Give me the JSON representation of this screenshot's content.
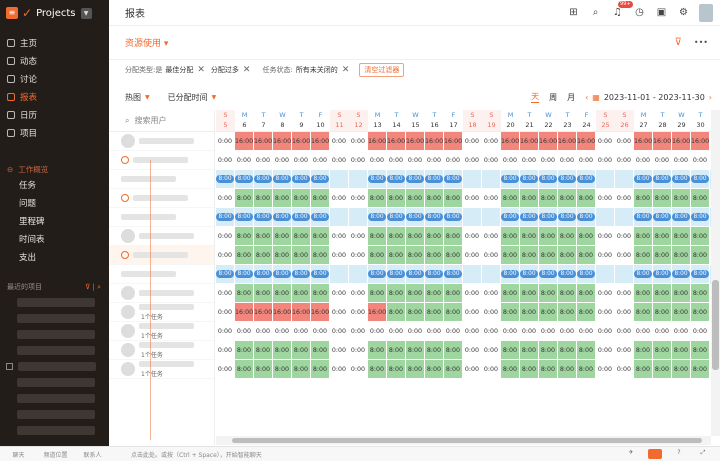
{
  "app": {
    "name": "Projects",
    "logo_letter": "≡",
    "logo_check": "✓"
  },
  "sidebar": {
    "nav": [
      {
        "label": "主页",
        "name": "home"
      },
      {
        "label": "动态",
        "name": "activity"
      },
      {
        "label": "讨论",
        "name": "discussion"
      },
      {
        "label": "报表",
        "name": "reports",
        "active": true
      },
      {
        "label": "日历",
        "name": "calendar"
      },
      {
        "label": "项目",
        "name": "projects"
      }
    ],
    "work_section": "工作概览",
    "work_items": [
      "任务",
      "问题",
      "里程碑",
      "时间表",
      "支出"
    ],
    "recent_title": "最近的项目"
  },
  "bottom": {
    "items": [
      "聊天",
      "频道位置",
      "联系人"
    ],
    "hint": "点击此处。或按（Ctrl + Space），开始智能聊天"
  },
  "header": {
    "title": "报表",
    "badge": "99+"
  },
  "sub_header": {
    "title": "资源使用",
    "caret": "▾",
    "filter_icon": "⊽",
    "more": "•••"
  },
  "filters": {
    "assign_label": "分配类型:是",
    "tags": [
      "最佳分配",
      "分配过多"
    ],
    "status_label": "任务状态:",
    "status_value": "所有未关闭的",
    "clear": "清空过滤器"
  },
  "toolbar": {
    "view_type": "热图",
    "assign_time": "已分配时间",
    "views": [
      "天",
      "周",
      "月"
    ],
    "date_range": "2023-11-01 - 2023-11-30"
  },
  "search": {
    "placeholder": "搜索用户"
  },
  "task_label": "1个任务",
  "days": {
    "weekday": [
      "S",
      "M",
      "T",
      "W",
      "T",
      "F",
      "S",
      "S",
      "M",
      "T",
      "W",
      "T",
      "F",
      "S",
      "S",
      "M",
      "T",
      "W",
      "T",
      "F",
      "S",
      "S",
      "M",
      "T",
      "W",
      "T"
    ],
    "date": [
      "5",
      "6",
      "7",
      "8",
      "9",
      "10",
      "11",
      "12",
      "13",
      "14",
      "15",
      "16",
      "17",
      "18",
      "19",
      "20",
      "21",
      "22",
      "23",
      "24",
      "25",
      "26",
      "27",
      "28",
      "29",
      "30"
    ]
  },
  "rows": [
    "w r r r r r w w r r r r r w w r r r r r w w r r r r",
    "w w w w w w w w w w w w w w w w w w w w w w w w w w",
    "b b b b b b x x b b b b b x x b b b b b x x b b b b",
    "w g g g g g w w g g g g g w w g g g g g w w g g g g",
    "b b b b b b x x b b b b b x x b b b b b x x b b b b",
    "w g g g g g w w g g g g g w w g g g g g w w g g g g",
    "w g g g g g w w g g g g g w w g g g g g w w g g g g",
    "b b b b b b x x b b b b b x x b b b b b x x b b b b",
    "w g g g g g w w g g g g g w w g g g g g w w g g g g",
    "w r r r r r w w r g g g g w w g g g g g w w g g g g",
    "w w w w w w w w w w w w w w w w w w w w w w w w w w",
    "w g g g g g w w g g g g g w w g g g g g w w g g g g",
    "w g g g g g w w g g g g g w w g g g g g w w g g g g"
  ],
  "values": {
    "r": "16:00",
    "g": "8:00",
    "w": "0:00",
    "b": "8:00"
  }
}
